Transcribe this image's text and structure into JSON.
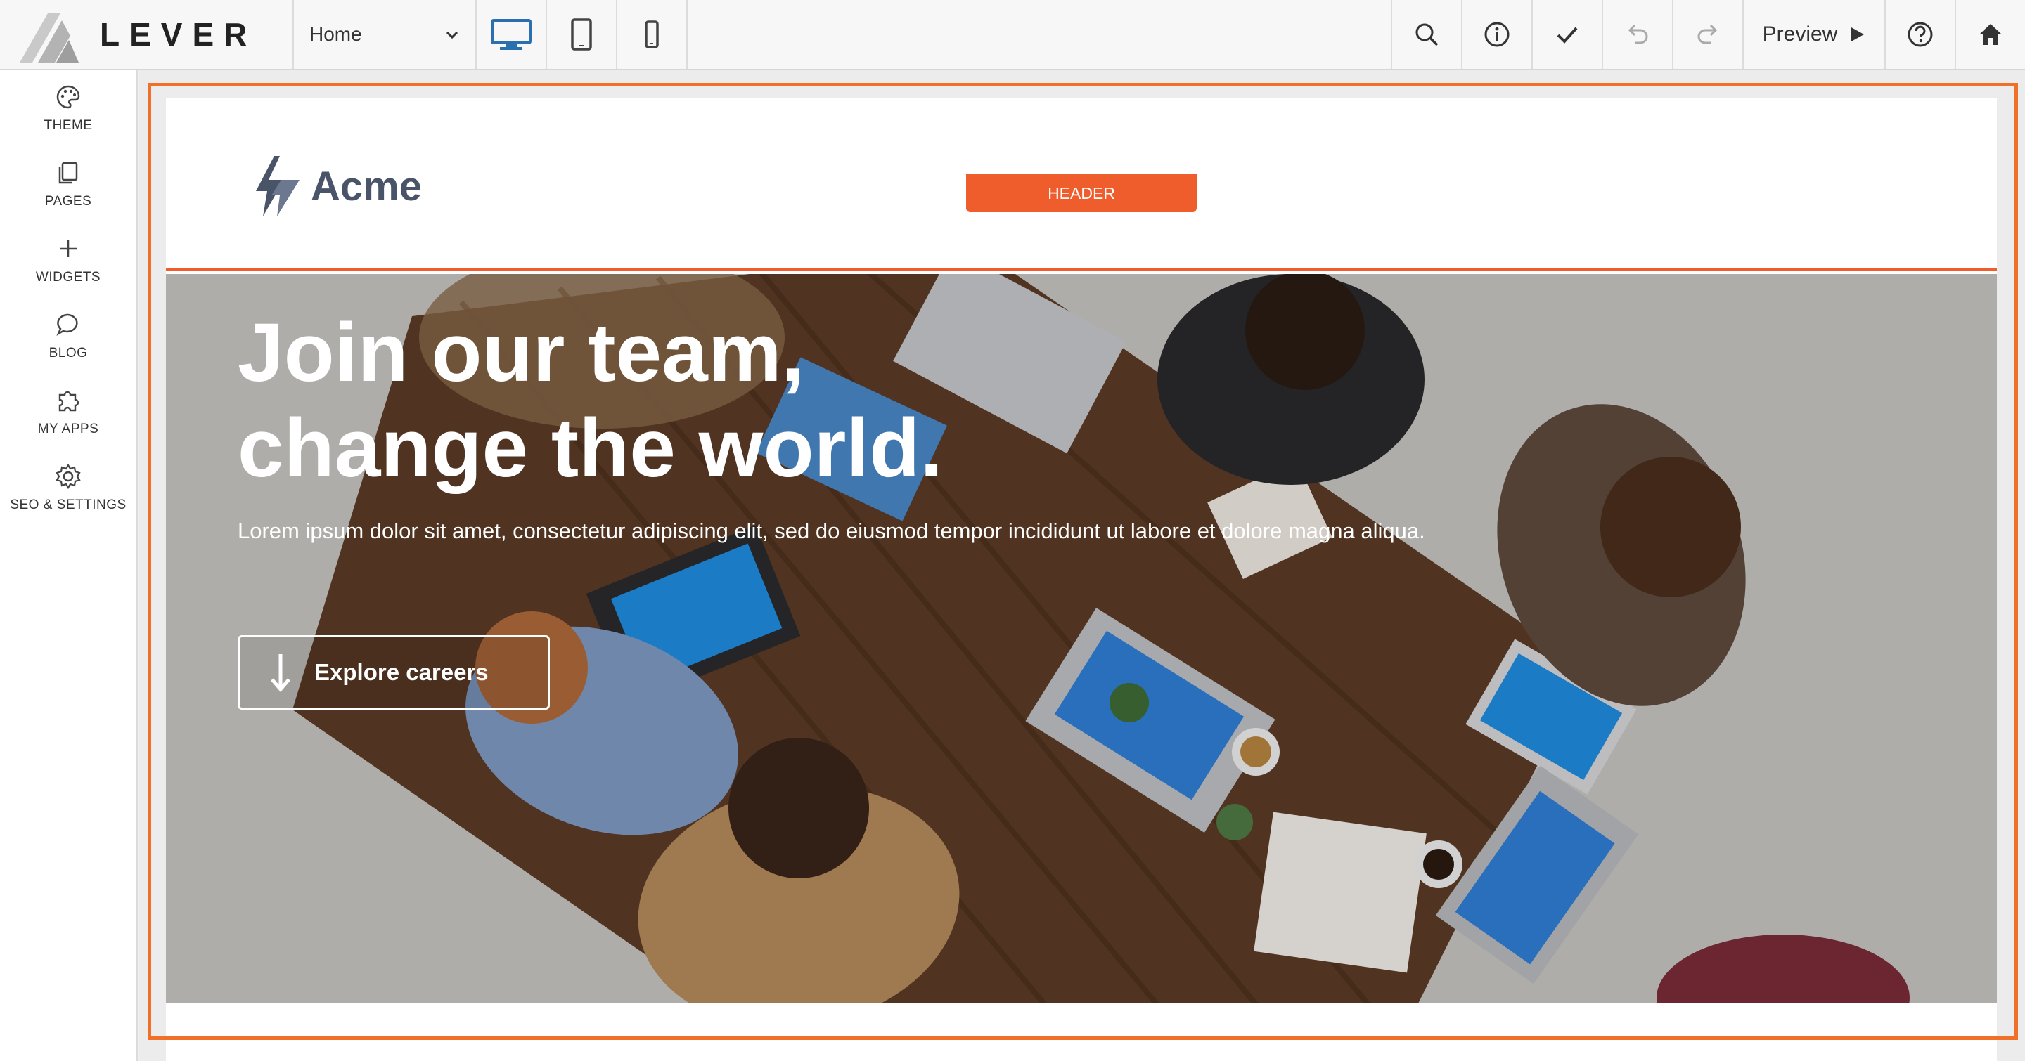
{
  "app": {
    "logo_text": "LEVER"
  },
  "toolbar": {
    "page_select": "Home",
    "preview_label": "Preview",
    "active_device": "desktop"
  },
  "sidebar": {
    "items": [
      {
        "label": "THEME",
        "icon": "palette-icon"
      },
      {
        "label": "PAGES",
        "icon": "pages-icon"
      },
      {
        "label": "WIDGETS",
        "icon": "plus-icon"
      },
      {
        "label": "BLOG",
        "icon": "chat-bubble-icon"
      },
      {
        "label": "MY APPS",
        "icon": "puzzle-icon"
      },
      {
        "label": "SEO & SETTINGS",
        "icon": "gear-icon"
      }
    ]
  },
  "site": {
    "brand": "Acme",
    "section_badge": "HEADER",
    "hero": {
      "title_line1": "Join our team,",
      "title_line2": "change the world.",
      "subtitle": "Lorem ipsum dolor sit amet, consectetur adipiscing elit, sed do eiusmod tempor incididunt ut labore et dolore magna aliqua.",
      "cta_label": "Explore careers"
    }
  },
  "colors": {
    "accent": "#f05d2c",
    "frame": "#f07029",
    "device_active": "#2a6fb0"
  }
}
